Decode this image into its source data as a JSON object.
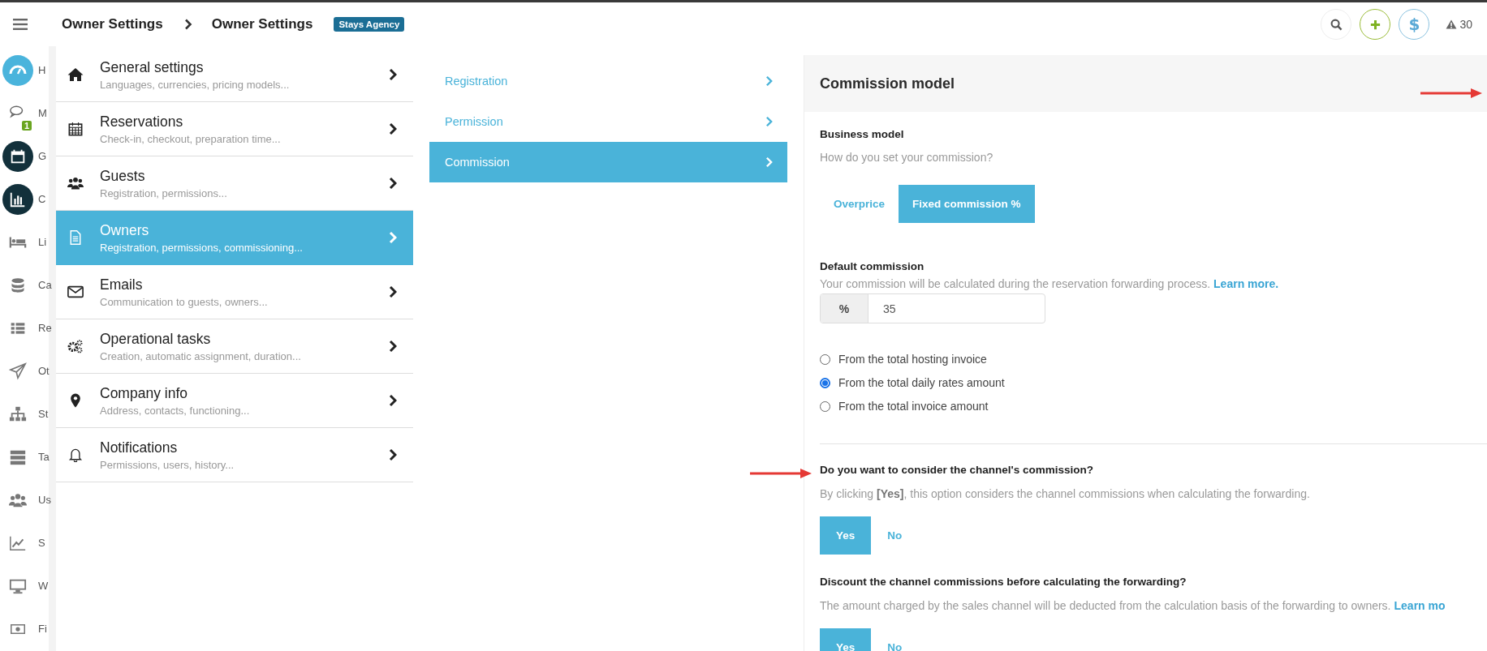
{
  "topbar": {
    "breadcrumb": [
      "Owner Settings",
      "Owner Settings"
    ],
    "badge": "Stays Agency",
    "currency": "$",
    "alerts": "30"
  },
  "rail": [
    {
      "label": "H",
      "kind": "bright"
    },
    {
      "label": "M",
      "kind": "plain",
      "count": "1"
    },
    {
      "label": "G",
      "kind": "dark"
    },
    {
      "label": "C",
      "kind": "dark"
    },
    {
      "label": "Li",
      "kind": "plain"
    },
    {
      "label": "Ca",
      "kind": "plain"
    },
    {
      "label": "Re",
      "kind": "plain"
    },
    {
      "label": "Ot",
      "kind": "plain"
    },
    {
      "label": "St",
      "kind": "plain"
    },
    {
      "label": "Ta",
      "kind": "plain"
    },
    {
      "label": "Us",
      "kind": "plain"
    },
    {
      "label": "S",
      "kind": "plain"
    },
    {
      "label": "W",
      "kind": "plain"
    },
    {
      "label": "Fi",
      "kind": "plain"
    }
  ],
  "settings": [
    {
      "title": "General settings",
      "subtitle": "Languages, currencies, pricing models...",
      "selected": false
    },
    {
      "title": "Reservations",
      "subtitle": "Check-in, checkout, preparation time...",
      "selected": false
    },
    {
      "title": "Guests",
      "subtitle": "Registration, permissions...",
      "selected": false
    },
    {
      "title": "Owners",
      "subtitle": "Registration, permissions, commissioning...",
      "selected": true
    },
    {
      "title": "Emails",
      "subtitle": "Communication to guests, owners...",
      "selected": false
    },
    {
      "title": "Operational tasks",
      "subtitle": "Creation, automatic assignment, duration...",
      "selected": false
    },
    {
      "title": "Company info",
      "subtitle": "Address, contacts, functioning...",
      "selected": false
    },
    {
      "title": "Notifications",
      "subtitle": "Permissions, users, history...",
      "selected": false
    }
  ],
  "submenu": [
    {
      "label": "Registration",
      "selected": false
    },
    {
      "label": "Permission",
      "selected": false
    },
    {
      "label": "Commission",
      "selected": true
    }
  ],
  "panel": {
    "title": "Commission model",
    "business_model": {
      "label": "Business model",
      "hint": "How do you set your commission?",
      "options": [
        {
          "label": "Overprice",
          "selected": false
        },
        {
          "label": "Fixed commission %",
          "selected": true
        }
      ]
    },
    "default_commission": {
      "label": "Default commission",
      "hint": "Your commission will be calculated during the reservation forwarding process.",
      "link": "Learn more.",
      "unit": "%",
      "value": "35"
    },
    "basis": [
      {
        "label": "From the total hosting invoice",
        "selected": false
      },
      {
        "label": "From the total daily rates amount",
        "selected": true
      },
      {
        "label": "From the total invoice amount",
        "selected": false
      }
    ],
    "questions": [
      {
        "label": "Do you want to consider the channel's commission?",
        "hint": "By clicking **[Yes]**, this option considers the channel commissions when calculating the forwarding.",
        "options": [
          {
            "label": "Yes",
            "selected": true
          },
          {
            "label": "No",
            "selected": false
          }
        ]
      },
      {
        "label": "Discount the channel commissions before calculating the forwarding?",
        "hint": "The amount charged by the sales channel will be deducted from the calculation basis of the forwarding to owners.",
        "link": "Learn mo",
        "options": [
          {
            "label": "Yes",
            "selected": true
          },
          {
            "label": "No",
            "selected": false
          }
        ]
      }
    ]
  }
}
